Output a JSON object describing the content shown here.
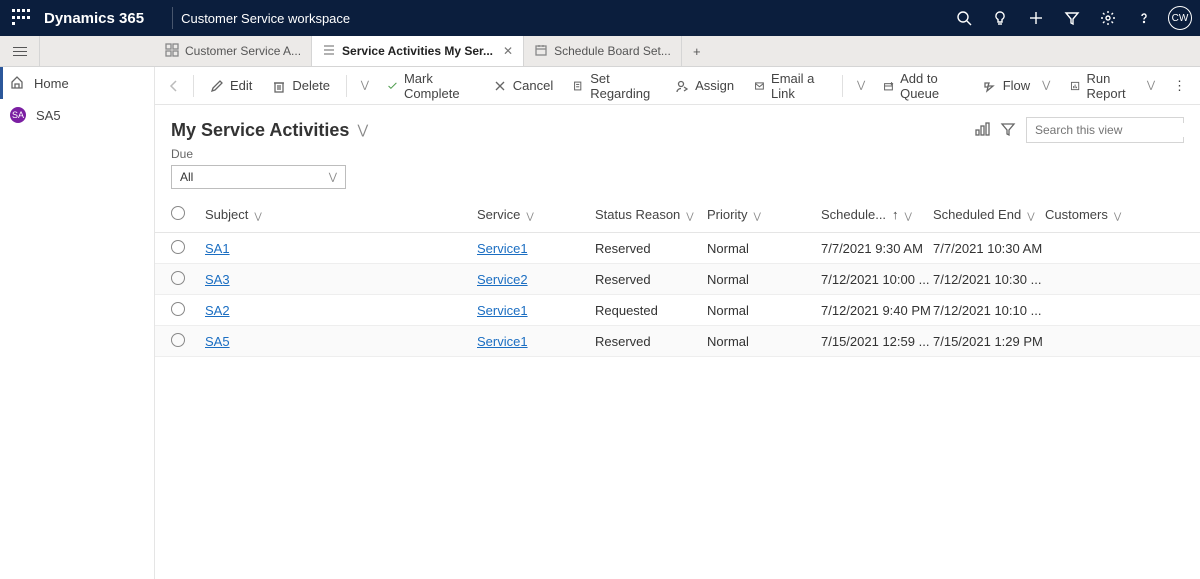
{
  "topbar": {
    "brand": "Dynamics 365",
    "workspace": "Customer Service workspace",
    "avatar": "CW"
  },
  "tabs": [
    {
      "label": "Customer Service A...",
      "active": false
    },
    {
      "label": "Service Activities My Ser...",
      "active": true
    },
    {
      "label": "Schedule Board Set...",
      "active": false
    }
  ],
  "sidebar": {
    "home": "Home",
    "record_badge": "SA",
    "record_label": "SA5"
  },
  "commands": {
    "edit": "Edit",
    "delete": "Delete",
    "mark_complete": "Mark Complete",
    "cancel": "Cancel",
    "set_regarding": "Set Regarding",
    "assign": "Assign",
    "email_link": "Email a Link",
    "add_to_queue": "Add to Queue",
    "flow": "Flow",
    "run_report": "Run Report"
  },
  "view": {
    "title": "My Service Activities",
    "search_placeholder": "Search this view"
  },
  "filter": {
    "label": "Due",
    "value": "All"
  },
  "grid": {
    "columns": {
      "subject": "Subject",
      "service": "Service",
      "status": "Status Reason",
      "priority": "Priority",
      "sched_start": "Schedule...",
      "sched_end": "Scheduled End",
      "customers": "Customers"
    },
    "rows": [
      {
        "subject": "SA1",
        "service": "Service1",
        "status": "Reserved",
        "priority": "Normal",
        "sched_start": "7/7/2021 9:30 AM",
        "sched_end": "7/7/2021 10:30 AM",
        "customers": ""
      },
      {
        "subject": "SA3",
        "service": "Service2",
        "status": "Reserved",
        "priority": "Normal",
        "sched_start": "7/12/2021 10:00 ...",
        "sched_end": "7/12/2021 10:30 ...",
        "customers": ""
      },
      {
        "subject": "SA2",
        "service": "Service1",
        "status": "Requested",
        "priority": "Normal",
        "sched_start": "7/12/2021 9:40 PM",
        "sched_end": "7/12/2021 10:10 ...",
        "customers": ""
      },
      {
        "subject": "SA5",
        "service": "Service1",
        "status": "Reserved",
        "priority": "Normal",
        "sched_start": "7/15/2021 12:59 ...",
        "sched_end": "7/15/2021 1:29 PM",
        "customers": ""
      }
    ]
  }
}
